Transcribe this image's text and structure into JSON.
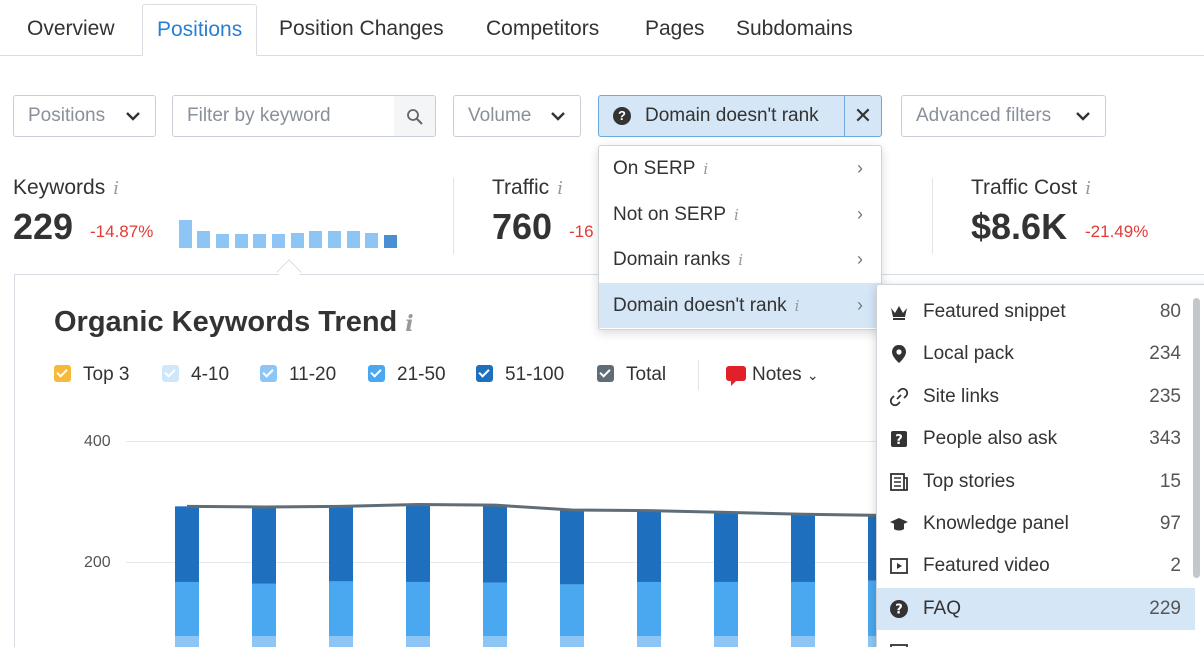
{
  "tabs": [
    "Overview",
    "Positions",
    "Position Changes",
    "Competitors",
    "Pages",
    "Subdomains"
  ],
  "active_tab": "Positions",
  "filters": {
    "positions_label": "Positions",
    "keyword_placeholder": "Filter by keyword",
    "volume_label": "Volume",
    "active_filter_label": "Domain doesn't rank",
    "advanced_label": "Advanced filters"
  },
  "metrics": {
    "keywords": {
      "label": "Keywords",
      "value": "229",
      "delta": "-14.87%"
    },
    "traffic": {
      "label": "Traffic",
      "value": "760",
      "delta": "-16"
    },
    "traffic_cost": {
      "label": "Traffic Cost",
      "value": "$8.6K",
      "delta": "-21.49%"
    }
  },
  "chart": {
    "title": "Organic Keywords Trend",
    "legend": [
      {
        "label": "Top 3",
        "color": "#f6b93b"
      },
      {
        "label": "4-10",
        "color": "#cfe7fb"
      },
      {
        "label": "11-20",
        "color": "#8dc6f5"
      },
      {
        "label": "21-50",
        "color": "#4aa8f0"
      },
      {
        "label": "51-100",
        "color": "#1f6fbf"
      },
      {
        "label": "Total",
        "color": "#5f6d78"
      }
    ],
    "notes_label": "Notes",
    "y_ticks": [
      "400",
      "200"
    ]
  },
  "chart_data": {
    "type": "bar",
    "title": "Organic Keywords Trend",
    "ylim": [
      0,
      400
    ],
    "series": [
      {
        "name": "51-100",
        "values": [
          125,
          127,
          124,
          128,
          128,
          123,
          118,
          115,
          112,
          108
        ]
      },
      {
        "name": "Total",
        "values": [
          292,
          291,
          292,
          295,
          294,
          286,
          285,
          282,
          279,
          277
        ]
      }
    ]
  },
  "submenu1": {
    "items": [
      "On SERP",
      "Not on SERP",
      "Domain ranks",
      "Domain doesn't rank"
    ],
    "active": "Domain doesn't rank"
  },
  "submenu2": {
    "items": [
      {
        "label": "Featured snippet",
        "count": "80",
        "icon": "crown-icon"
      },
      {
        "label": "Local pack",
        "count": "234",
        "icon": "location-pin-icon"
      },
      {
        "label": "Site links",
        "count": "235",
        "icon": "link-icon"
      },
      {
        "label": "People also ask",
        "count": "343",
        "icon": "question-box-icon"
      },
      {
        "label": "Top stories",
        "count": "15",
        "icon": "newspaper-icon"
      },
      {
        "label": "Knowledge panel",
        "count": "97",
        "icon": "graduation-cap-icon"
      },
      {
        "label": "Featured video",
        "count": "2",
        "icon": "video-icon"
      },
      {
        "label": "FAQ",
        "count": "229",
        "icon": "question-circle-icon"
      }
    ],
    "active": "FAQ"
  },
  "colors": {
    "accent": "#2a7fd3",
    "active_bg": "#d5e6f7",
    "negative": "#e53935"
  }
}
